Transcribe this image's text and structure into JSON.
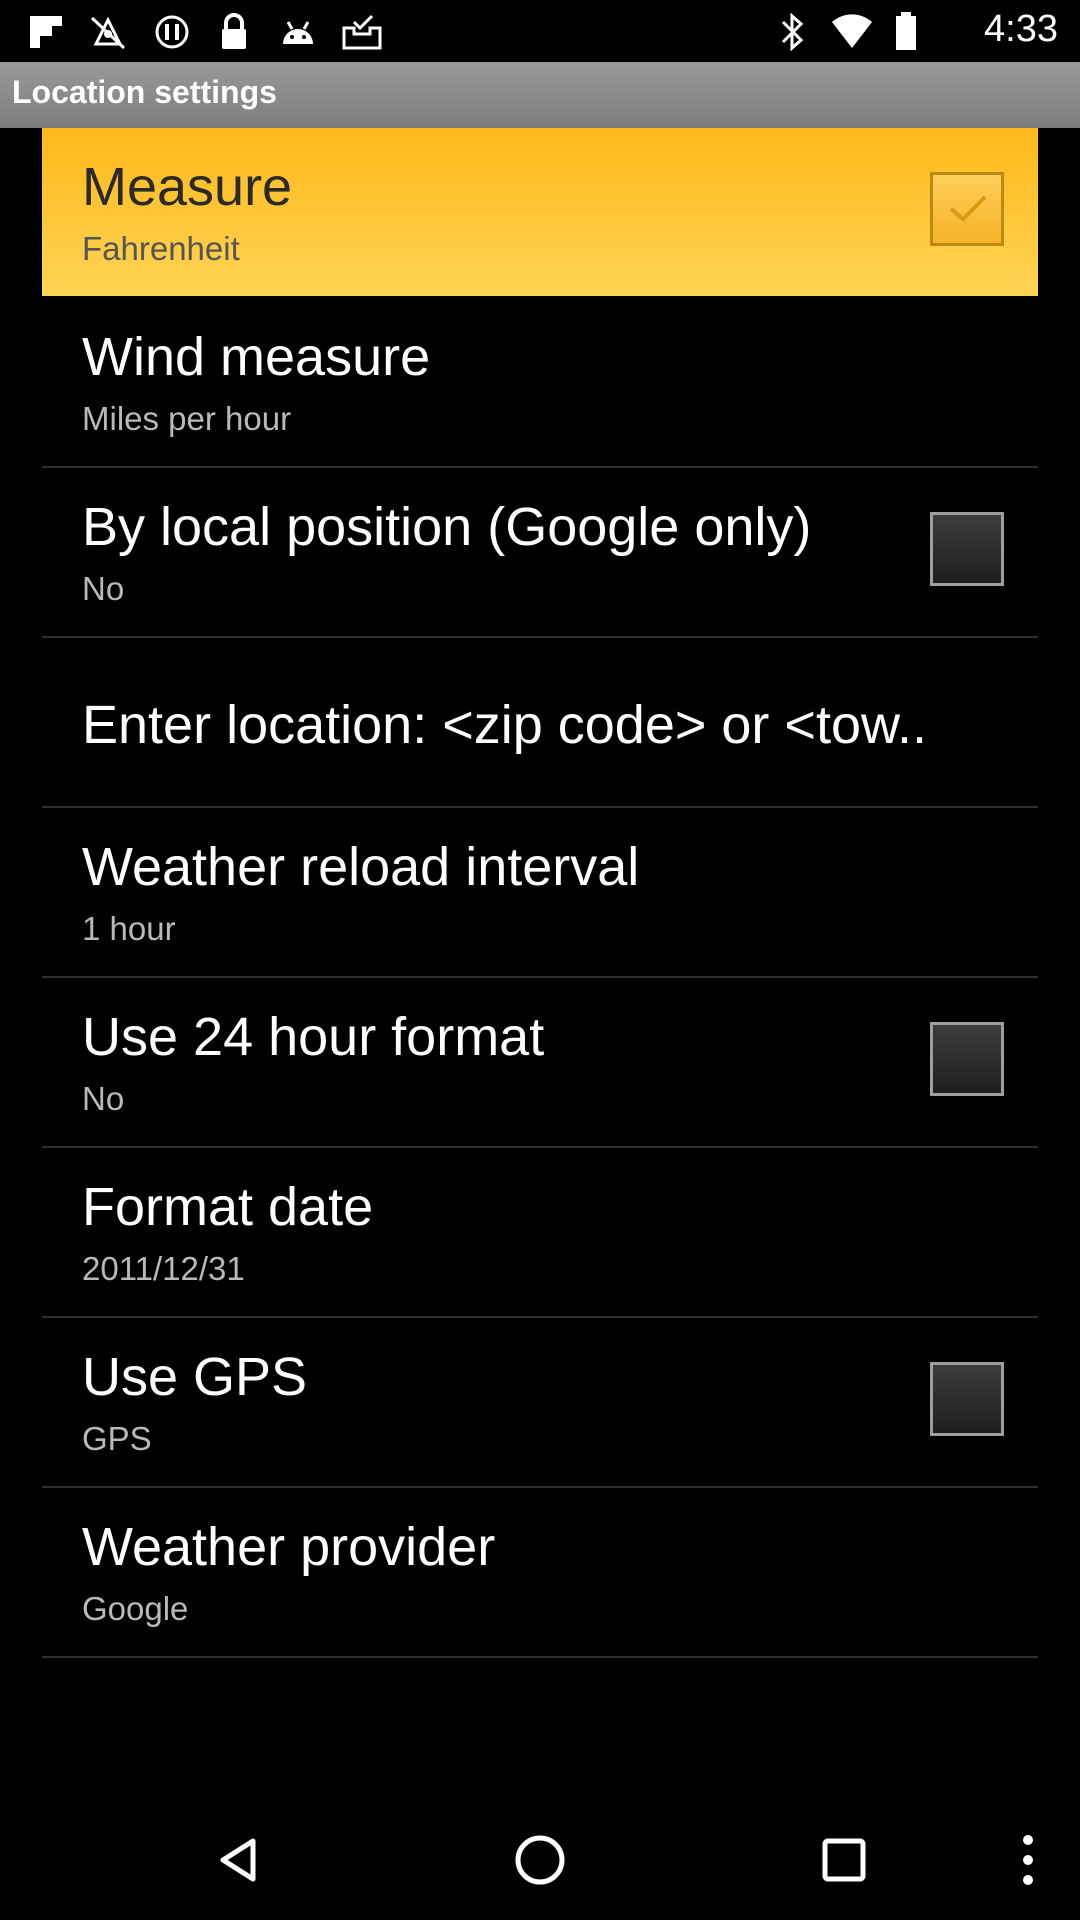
{
  "status_bar": {
    "time": "4:33",
    "left_icons": [
      "flipboard-icon",
      "fake-gps-icon",
      "sync-icon",
      "lock-icon",
      "android-icon",
      "task-icon"
    ],
    "right_icons": [
      "bluetooth-icon"
    ]
  },
  "title_bar": {
    "title": "Location settings"
  },
  "settings": [
    {
      "title": "Measure",
      "summary": "Fahrenheit",
      "has_checkbox": true,
      "checked": true,
      "highlighted": true
    },
    {
      "title": "Wind measure",
      "summary": "Miles per hour",
      "has_checkbox": false
    },
    {
      "title": "By local position (Google only)",
      "summary": "No",
      "has_checkbox": true,
      "checked": false
    },
    {
      "title": "Enter location: <zip code> or <tow..",
      "summary": "",
      "has_checkbox": false
    },
    {
      "title": "Weather reload interval",
      "summary": "1 hour",
      "has_checkbox": false
    },
    {
      "title": "Use 24 hour format",
      "summary": "No",
      "has_checkbox": true,
      "checked": false
    },
    {
      "title": "Format date",
      "summary": "2011/12/31",
      "has_checkbox": false
    },
    {
      "title": "Use GPS",
      "summary": "GPS",
      "has_checkbox": true,
      "checked": false
    },
    {
      "title": "Weather provider",
      "summary": "Google",
      "has_checkbox": false
    }
  ],
  "nav_bar": {
    "buttons": [
      "back-icon",
      "home-icon",
      "recents-icon",
      "overflow-menu-icon"
    ]
  },
  "colors": {
    "highlight_top": "#ffb81a",
    "highlight_bottom": "#ffd455",
    "title_bar": "#8a8a8a",
    "background": "#000000"
  }
}
